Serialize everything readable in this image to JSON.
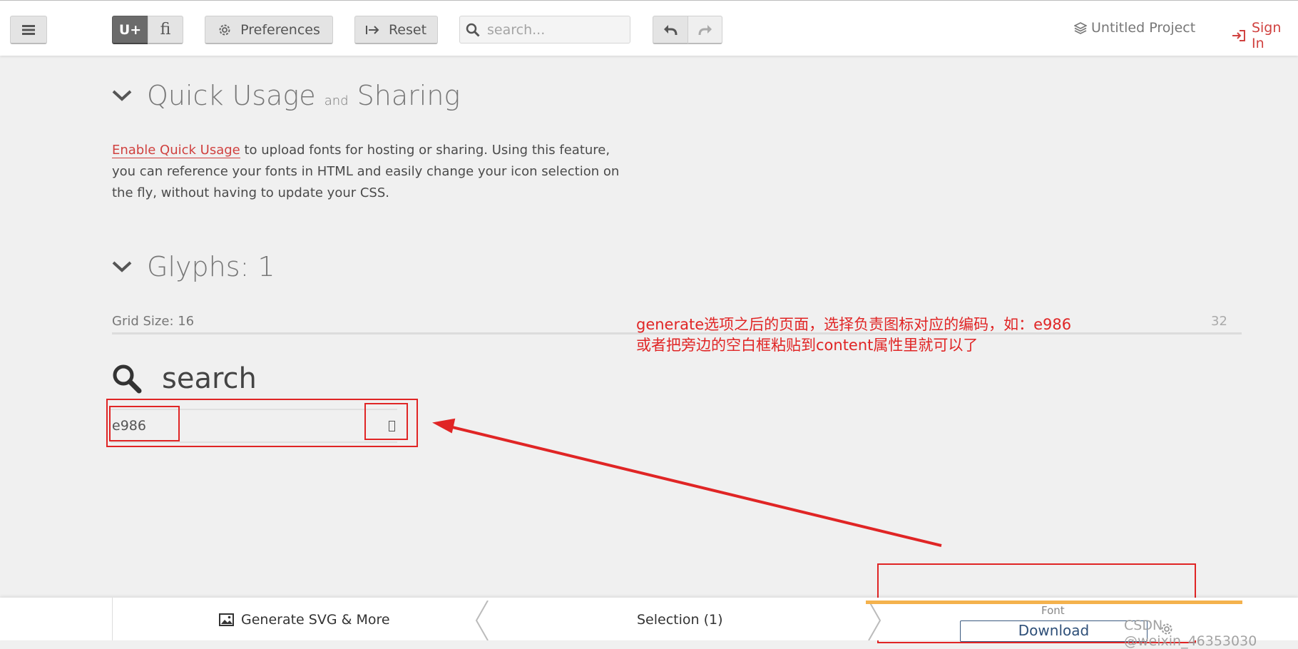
{
  "topbar": {
    "menu_icon": "hamburger-icon",
    "unicode_toggle_label": "U+",
    "ligature_toggle_label": "fi",
    "preferences_label": "Preferences",
    "reset_label": "Reset",
    "search_placeholder": "search...",
    "undo_icon": "undo-icon",
    "redo_icon": "redo-icon",
    "project_name": "Untitled Project",
    "signin_label": "Sign In"
  },
  "quick_usage": {
    "title_main": "Quick Usage",
    "title_and": "and",
    "title_end": "Sharing",
    "link_text": "Enable Quick Usage",
    "body_text": " to upload fonts for hosting or sharing. Using this feature, you can reference your fonts in HTML and easily change your icon selection on the fly, without having to update your CSS."
  },
  "glyphs": {
    "title": "Glyphs: 1",
    "grid_size_label": "Grid Size: 16",
    "grid_max": "32",
    "items": [
      {
        "icon": "search-icon",
        "name": "search",
        "code": "e986",
        "char": ""
      }
    ]
  },
  "annotation": {
    "line1": "generate选项之后的页面，选择负责图标对应的编码，如：e986",
    "line2": "或者把旁边的空白框粘贴到content属性里就可以了",
    "color": "#e02525"
  },
  "bottombar": {
    "generate_label": "Generate SVG & More",
    "selection_label": "Selection (1)",
    "font_label": "Font",
    "download_label": "Download",
    "accent_color": "#f4b24d"
  },
  "watermark": "CSDN @weixin_46353030"
}
